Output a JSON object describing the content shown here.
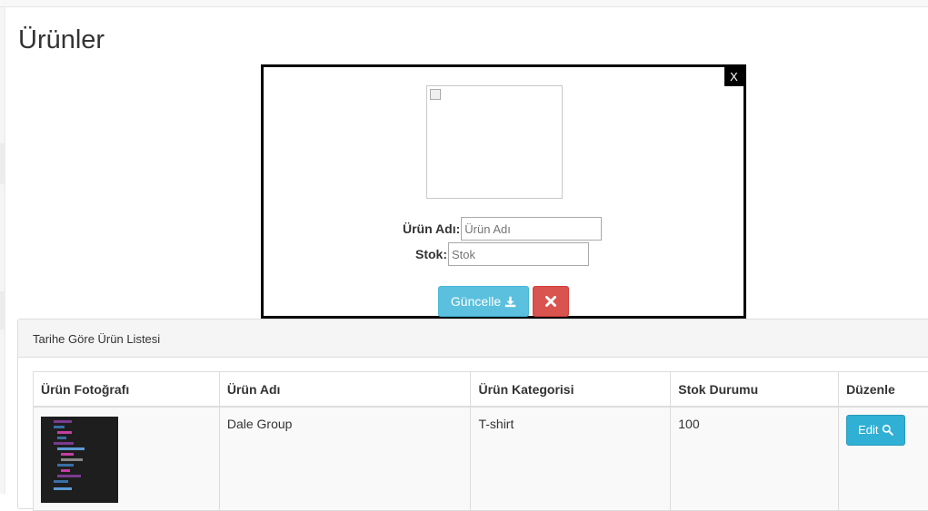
{
  "page": {
    "title": "Ürünler"
  },
  "panel": {
    "heading": "Tarihe Göre Ürün Listesi",
    "table": {
      "headers": [
        "Ürün Fotoğrafı",
        "Ürün Adı",
        "Ürün Kategorisi",
        "Stok Durumu",
        "Düzenle"
      ],
      "rows": [
        {
          "name": "Dale Group",
          "category": "T-shirt",
          "stock": "100",
          "edit_label": "Edit"
        }
      ]
    }
  },
  "modal": {
    "close_label": "X",
    "name_label": "Ürün Adı:",
    "name_placeholder": "Ürün Adı",
    "stock_label": "Stok:",
    "stock_placeholder": "Stok",
    "update_label": "Güncelle"
  },
  "colors": {
    "info": "#5bc0de",
    "danger": "#d9534f",
    "edit_button": "#31b0d5"
  },
  "icons": {
    "update": "download-icon",
    "cancel": "times-icon",
    "edit": "search-icon"
  }
}
